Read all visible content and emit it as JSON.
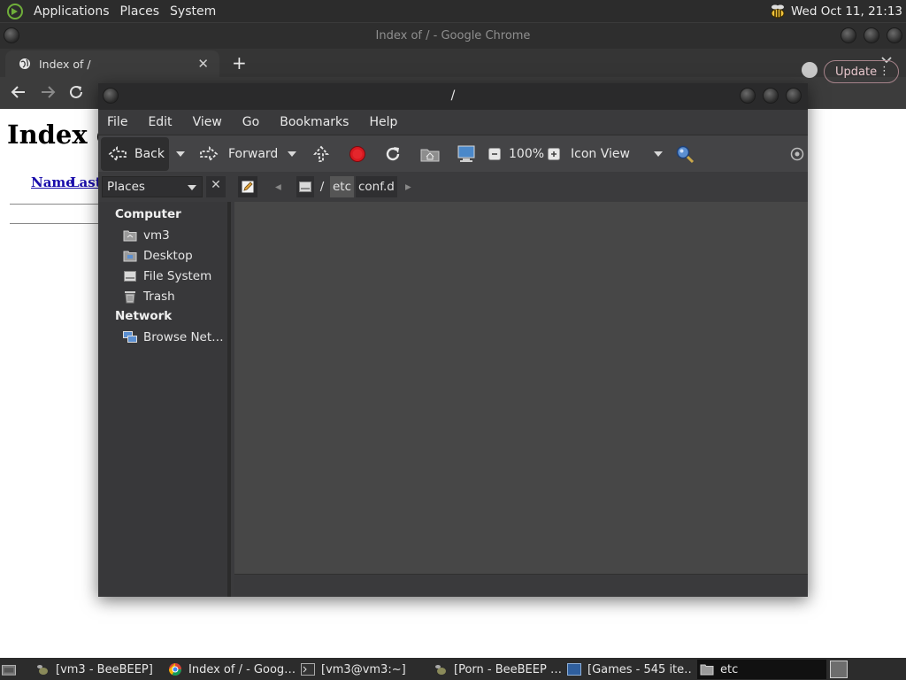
{
  "top_panel": {
    "menus": [
      "Applications",
      "Places",
      "System"
    ],
    "clock": "Wed Oct 11, 21:13"
  },
  "chrome": {
    "window_title": "Index of / - Google Chrome",
    "tab_title": "Index of /",
    "update_label": "Update",
    "page": {
      "heading": "Index o",
      "col_name": "Name",
      "col_last": "Last"
    }
  },
  "file_manager": {
    "window_title": "/",
    "menu": [
      "File",
      "Edit",
      "View",
      "Go",
      "Bookmarks",
      "Help"
    ],
    "toolbar": {
      "back": "Back",
      "forward": "Forward",
      "zoom": "100%",
      "view_mode": "Icon View"
    },
    "side_pane_select": "Places",
    "breadcrumb": [
      "/",
      "etc",
      "conf.d"
    ],
    "sidebar": {
      "computer_heading": "Computer",
      "computer_items": [
        "vm3",
        "Desktop",
        "File System",
        "Trash"
      ],
      "network_heading": "Network",
      "network_items": [
        "Browse Net…"
      ]
    }
  },
  "taskbar": {
    "tasks": [
      "[vm3 - BeeBEEP]",
      "Index of / - Goog…",
      "[vm3@vm3:~]",
      "[Porn - BeeBEEP …",
      "[Games - 545 ite…",
      "etc"
    ]
  }
}
